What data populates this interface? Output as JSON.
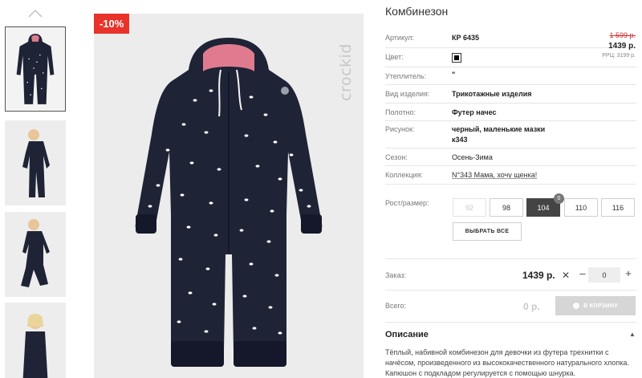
{
  "gallery": {
    "discount_badge": "-10%",
    "brand_watermark": "crockid",
    "thumbnails": [
      {
        "active": true
      },
      {
        "active": false
      },
      {
        "active": false
      },
      {
        "active": false
      }
    ]
  },
  "product": {
    "title": "Комбинезон",
    "attributes": [
      {
        "label": "Артикул:",
        "value": "КР 6435"
      },
      {
        "label": "Цвет:",
        "value": ""
      },
      {
        "label": "Утеплитель:",
        "value": "\""
      },
      {
        "label": "Вид изделия:",
        "value": "Трикотажные изделия"
      },
      {
        "label": "Полотно:",
        "value": "Футер начес"
      },
      {
        "label": "Рисунок:",
        "value": "черный, маленькие мазки",
        "value2": "к343"
      },
      {
        "label": "Сезон:",
        "value": "Осень-Зима"
      },
      {
        "label": "Коллекция:",
        "value": "N°343 Мама, хочу щенка!"
      }
    ],
    "color_swatch": "#000000",
    "price_old": "1 599 р.",
    "price_new": "1439 р.",
    "price_rrp": "РРЦ: 3199 р."
  },
  "sizes": {
    "label": "Рост/размер:",
    "options": [
      {
        "label": "92",
        "state": "disabled"
      },
      {
        "label": "98",
        "state": "normal"
      },
      {
        "label": "104",
        "state": "selected"
      },
      {
        "label": "110",
        "state": "normal"
      },
      {
        "label": "116",
        "state": "normal"
      }
    ],
    "badge": "0",
    "select_all": "ВЫБРАТЬ ВСЕ"
  },
  "order": {
    "label": "Заказ:",
    "price": "1439 р.",
    "x_symbol": "✕",
    "minus": "–",
    "quantity": "0",
    "plus": "+"
  },
  "total": {
    "label": "Всего:",
    "value": "0 р.",
    "cart_button": "В КОРЗИНУ"
  },
  "description": {
    "title": "Описание",
    "chevron": "▲",
    "text": "Тёплый, набивной комбинезон для девочки из футера трехнитки с начёсом, произведенного из высококачественного натурального хлопка. Капюшон с подкладом регулируется с помощью шнурка."
  },
  "colors": {
    "accent": "#e8332a",
    "garment": "#1f2336",
    "hood_lining": "#e07b8f",
    "selected_size": "#444444"
  }
}
